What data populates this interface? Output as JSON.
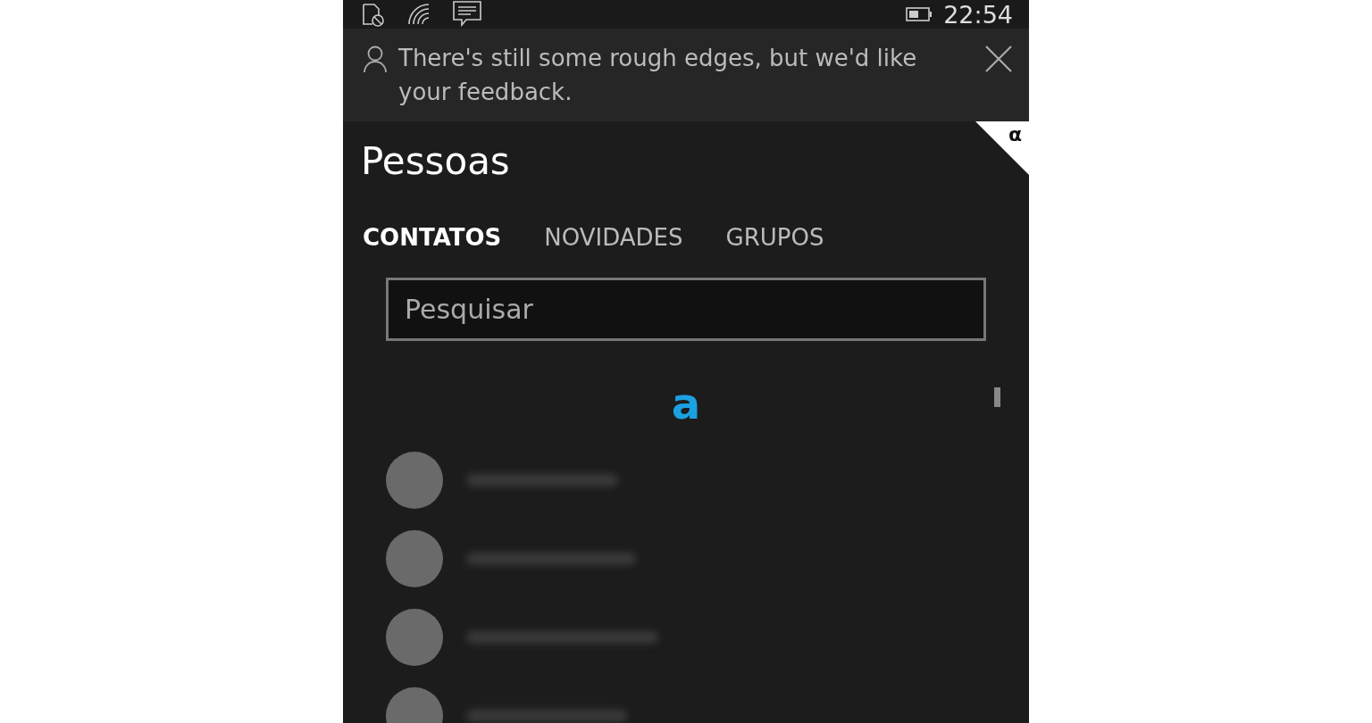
{
  "status_bar": {
    "time": "22:54"
  },
  "banner": {
    "message": "There's still some rough edges, but we'd like your feedback."
  },
  "corner_badge": {
    "symbol": "α"
  },
  "title": "Pessoas",
  "tabs": [
    {
      "label": "CONTATOS",
      "selected": true
    },
    {
      "label": "NOVIDADES",
      "selected": false
    },
    {
      "label": "GRUPOS",
      "selected": false
    }
  ],
  "search": {
    "placeholder": "Pesquisar"
  },
  "index_letter": "a"
}
